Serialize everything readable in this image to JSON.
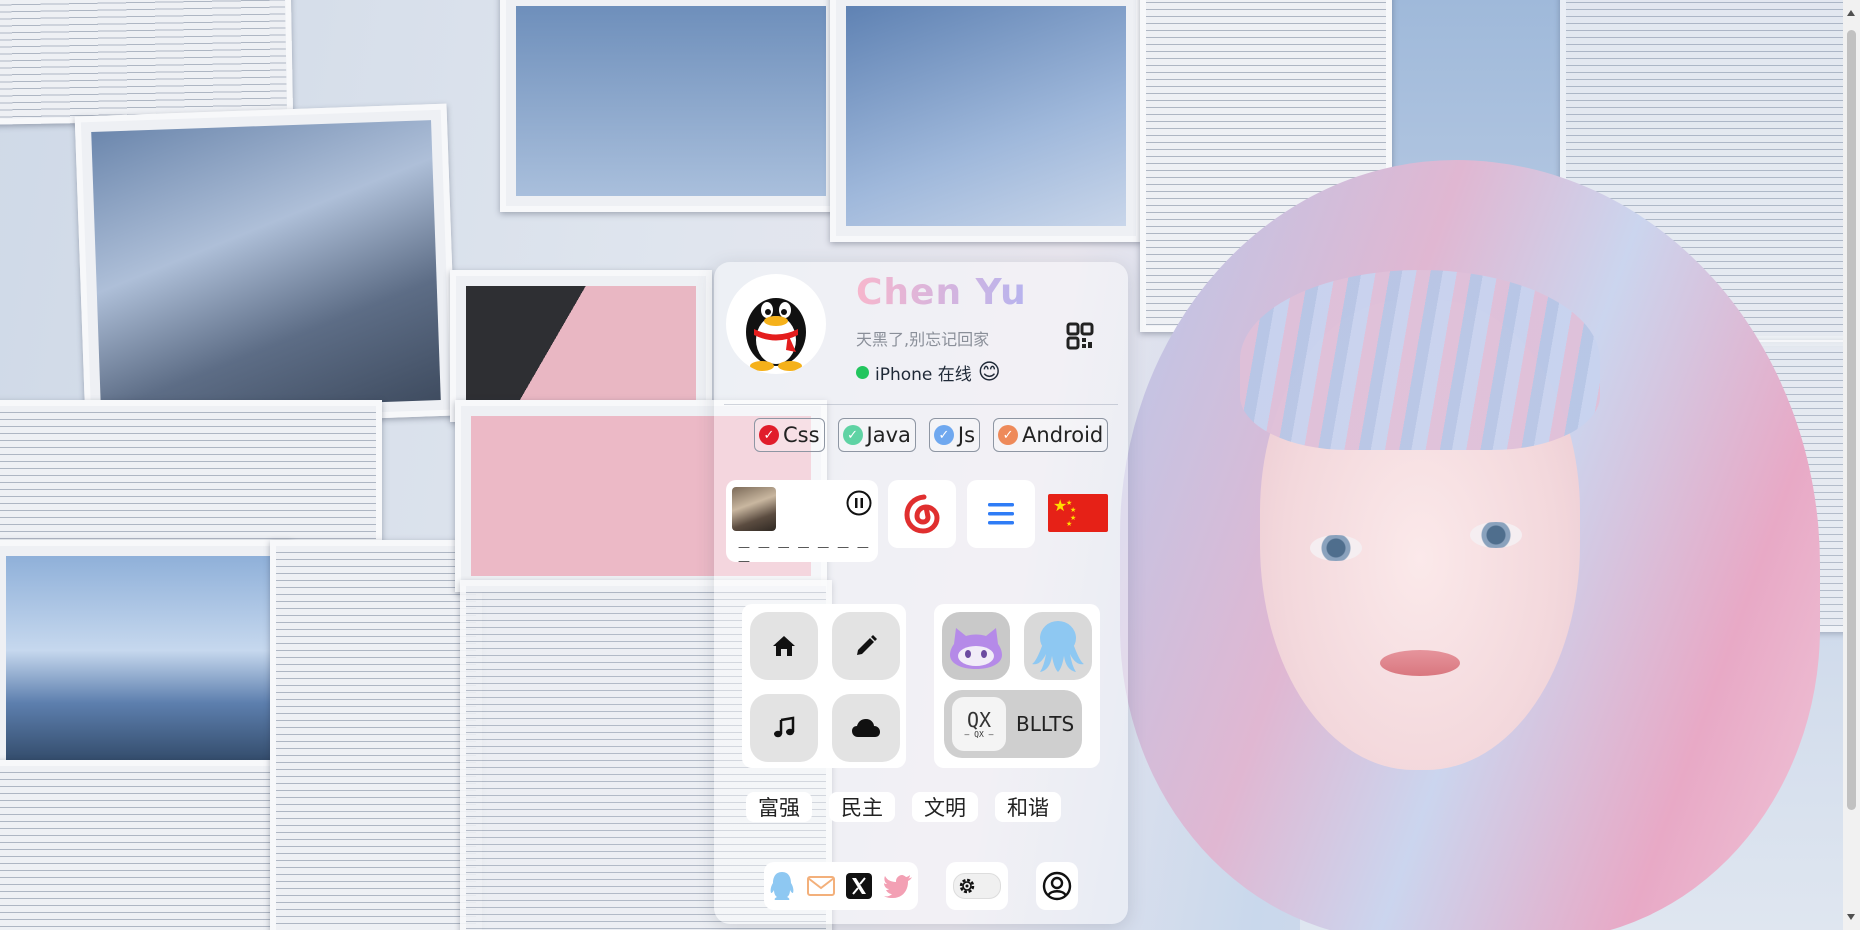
{
  "profile": {
    "name": "Chen Yu",
    "motto": "天黑了,别忘记回家",
    "status_text": "iPhone 在线",
    "status_emoji": "😊"
  },
  "tags": [
    {
      "label": "Css",
      "color": "#e11d2b"
    },
    {
      "label": "Java",
      "color": "#5fd3a4"
    },
    {
      "label": "Js",
      "color": "#6fa8ef"
    },
    {
      "label": "Android",
      "color": "#ee8a5a"
    }
  ],
  "player": {
    "progress_dashes": "— — — — — — — —"
  },
  "brand": {
    "qx_logo_text": "QX",
    "qx_logo_sub": "— QX —",
    "bllts_label": "BLLTS"
  },
  "values": [
    "富强",
    "民主",
    "文明",
    "和谐"
  ],
  "colors": {
    "netease_red": "#e02f2f",
    "menu_blue": "#2f7cf6",
    "flag_red": "#e62117",
    "flag_star": "#ffde00",
    "status_green": "#22c55e",
    "qq_blue": "#8ec8f2",
    "mail_orange": "#f3b07b",
    "twitter_pink": "#f3a0b4"
  },
  "icons": {
    "home": "home-icon",
    "edit": "pencil-icon",
    "music": "music-note-icon",
    "cloud": "cloud-icon",
    "github": "github-cat-icon",
    "octopus": "octopus-icon",
    "qq": "qq-penguin-icon",
    "mail": "mail-icon",
    "x": "x-logo-icon",
    "twitter": "twitter-bird-icon",
    "gear": "gear-icon",
    "user": "user-circle-icon",
    "qr": "qr-code-icon"
  }
}
